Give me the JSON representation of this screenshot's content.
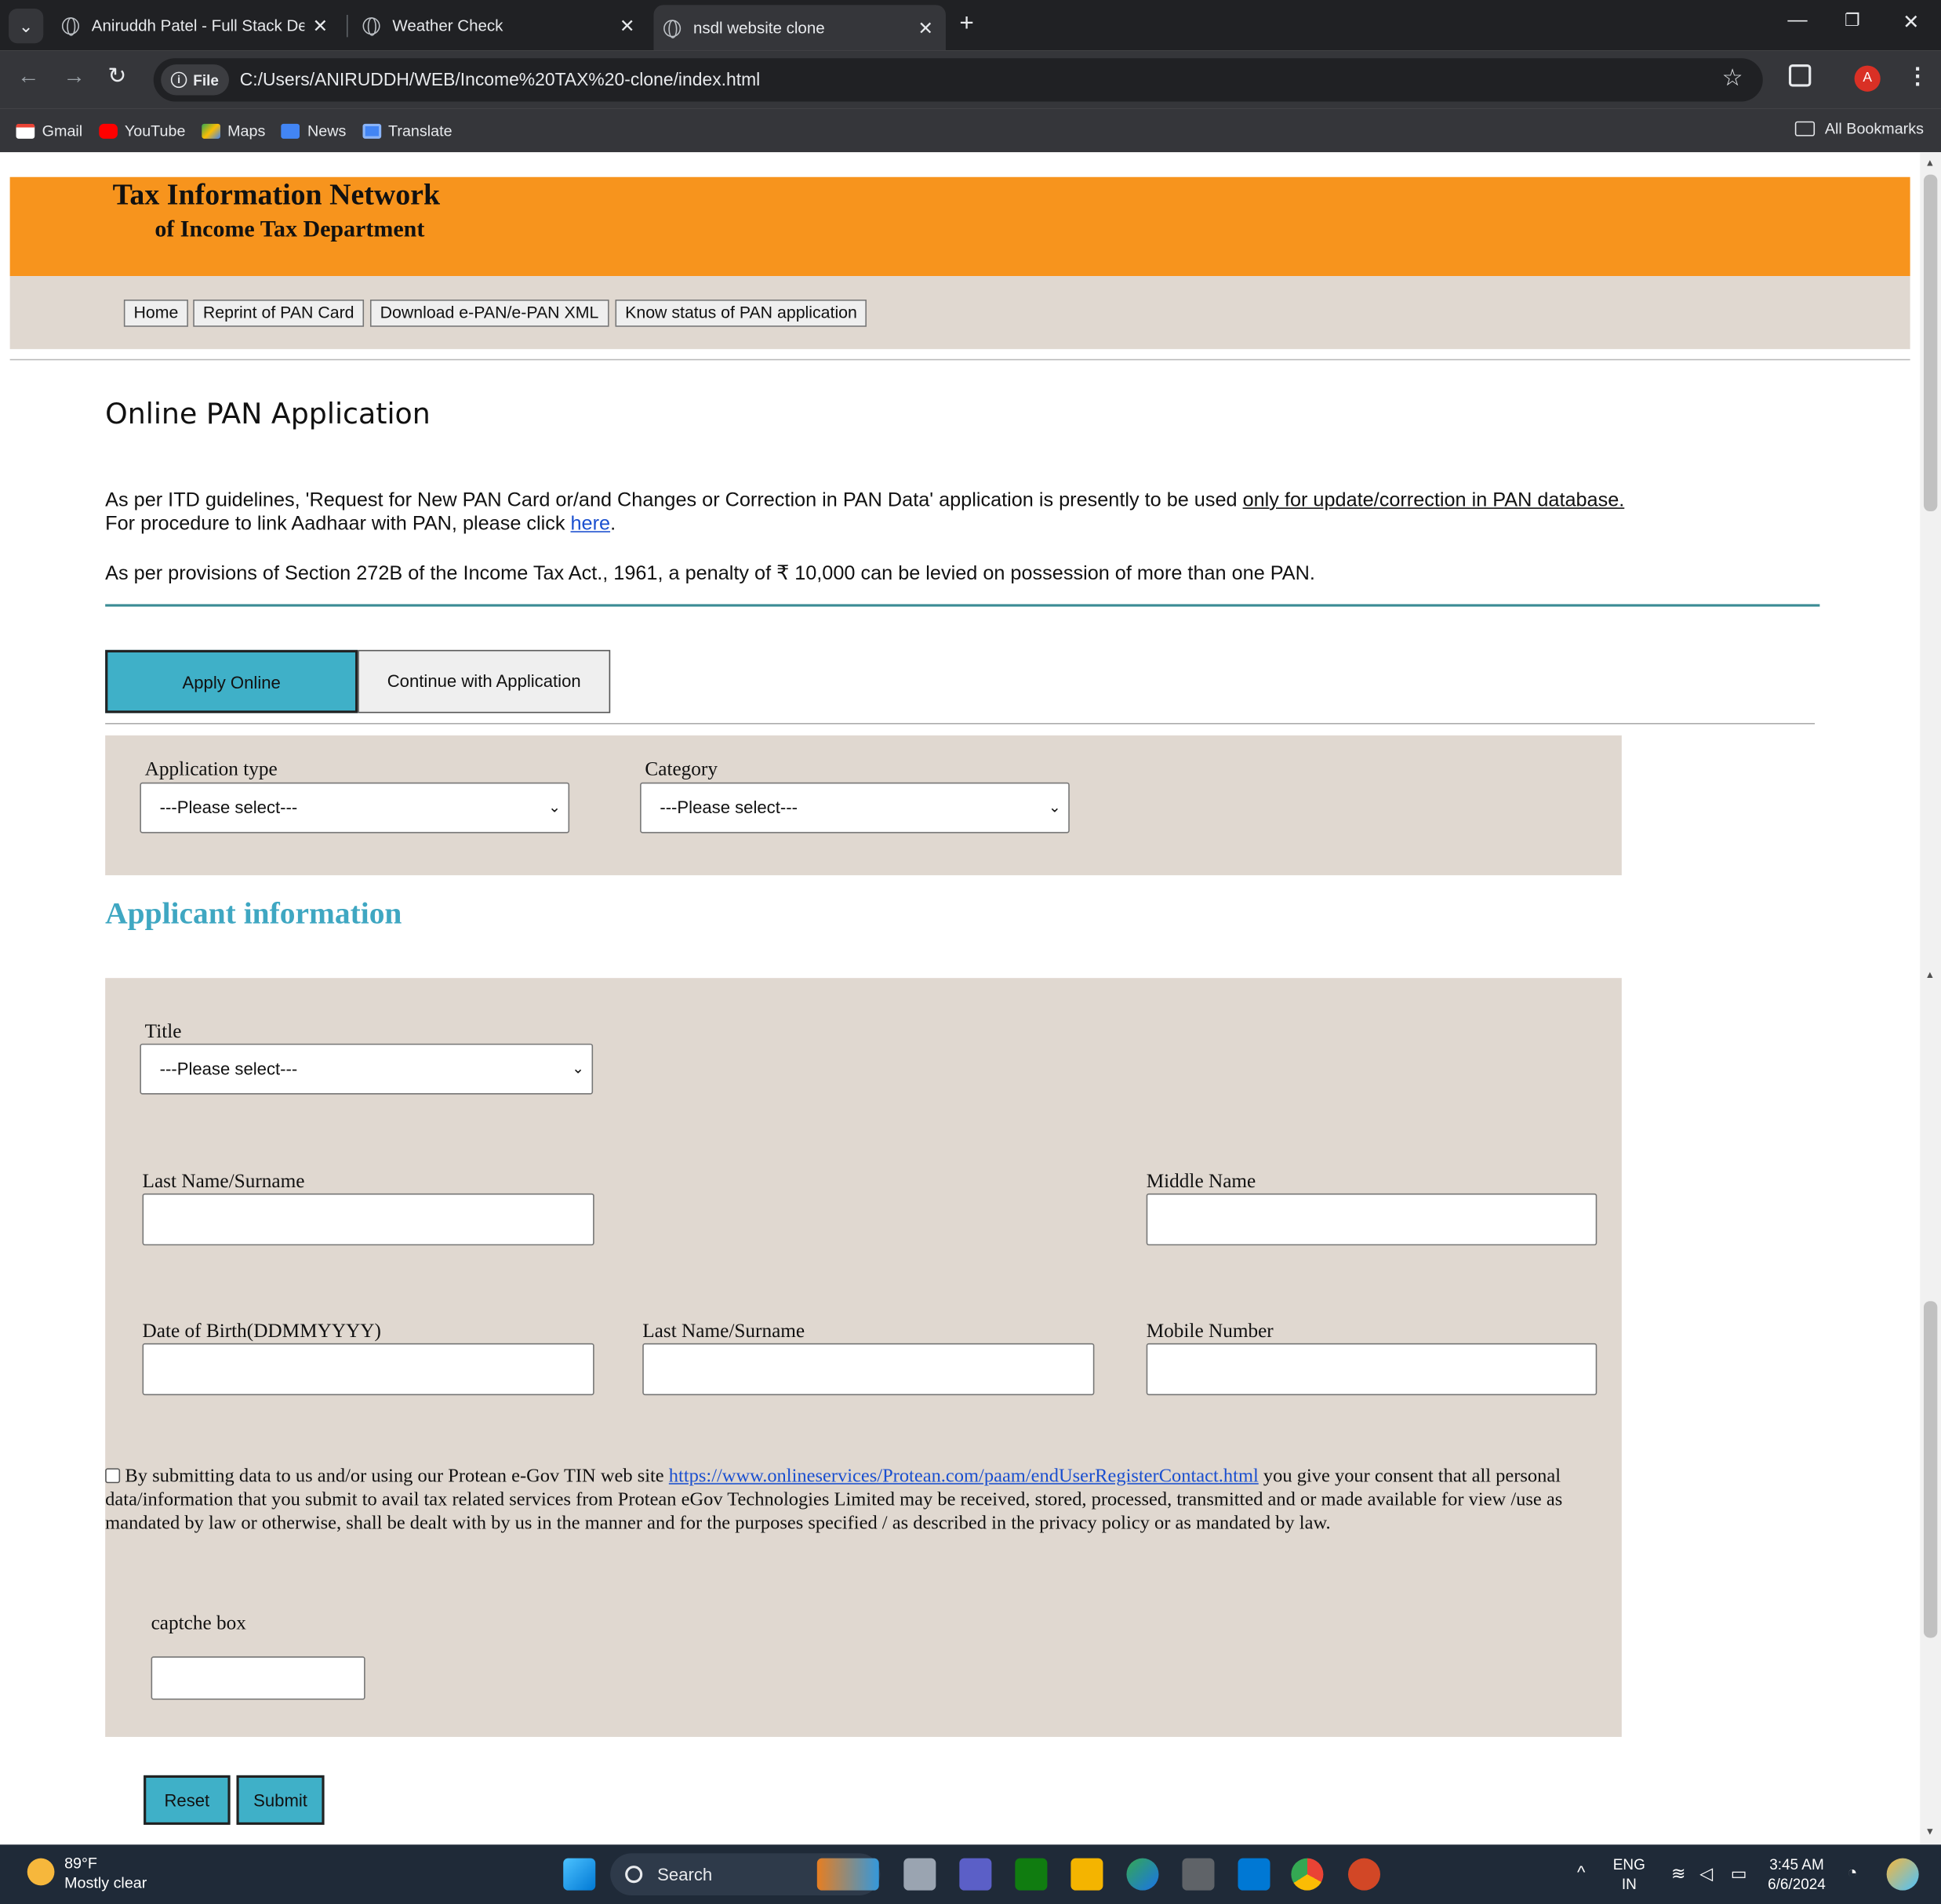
{
  "browser": {
    "tabs": [
      {
        "title": "Aniruddh Patel - Full Stack Deve",
        "active": false
      },
      {
        "title": "Weather Check",
        "active": false
      },
      {
        "title": "nsdl website clone",
        "active": true
      }
    ],
    "address_chip": "File",
    "url": "C:/Users/ANIRUDDH/WEB/Income%20TAX%20-clone/index.html",
    "profile_initial": "A",
    "bookmarks": [
      "Gmail",
      "YouTube",
      "Maps",
      "News",
      "Translate"
    ],
    "all_bookmarks": "All Bookmarks"
  },
  "header": {
    "title": "Tax Information Network",
    "subtitle": "of Income Tax Department",
    "color": "#f7941d"
  },
  "nav": [
    "Home",
    "Reprint of PAN Card",
    "Download e-PAN/e-PAN XML",
    "Know status of PAN application"
  ],
  "main": {
    "heading": "Online PAN Application",
    "para1_prefix": "As per ITD guidelines, 'Request for New PAN Card or/and Changes or Correction in PAN Data' application is presently to be used ",
    "para1_link": "only for update/correction in PAN database.",
    "para2_prefix": "For procedure to link Aadhaar with PAN, please click ",
    "para2_link": "here",
    "para2_suffix": ".",
    "para3": "As per provisions of Section 272B of the Income Tax Act., 1961, a penalty of ₹ 10,000 can be levied on possession of more than one PAN.",
    "tab_apply": "Apply Online",
    "tab_continue": "Continue with Application",
    "accent": "#3fb0c8"
  },
  "selection": {
    "application_type_label": "Application type",
    "application_type_value": "---Please select---",
    "category_label": "Category",
    "category_value": "---Please select---"
  },
  "applicant": {
    "heading": "Applicant information",
    "title_label": "Title",
    "title_value": "---Please select---",
    "last_name_label": "Last Name/Surname",
    "middle_name_label": "Middle Name",
    "dob_label": "Date of Birth(DDMMYYYY)",
    "last_name_label_2": "Last Name/Surname",
    "mobile_label": "Mobile Number",
    "consent_prefix": "By submitting data to us and/or using our Protean e-Gov TIN web site ",
    "consent_link": "https://www.onlineservices/Protean.com/paam/endUserRegisterContact.html",
    "consent_suffix": " you give your consent that all personal data/information that you submit to avail tax related services from Protean eGov Technologies Limited may be received, stored, processed, transmitted and or made available for view /use as mandated by law or otherwise, shall be dealt with by us in the manner and for the purposes specified / as described in the privacy policy or as mandated by law.",
    "captcha_label": "captche box",
    "reset": "Reset",
    "submit": "Submit"
  },
  "taskbar": {
    "temperature": "89°F",
    "weather": "Mostly clear",
    "search": "Search",
    "lang1": "ENG",
    "lang2": "IN",
    "time": "3:45 AM",
    "date": "6/6/2024"
  }
}
